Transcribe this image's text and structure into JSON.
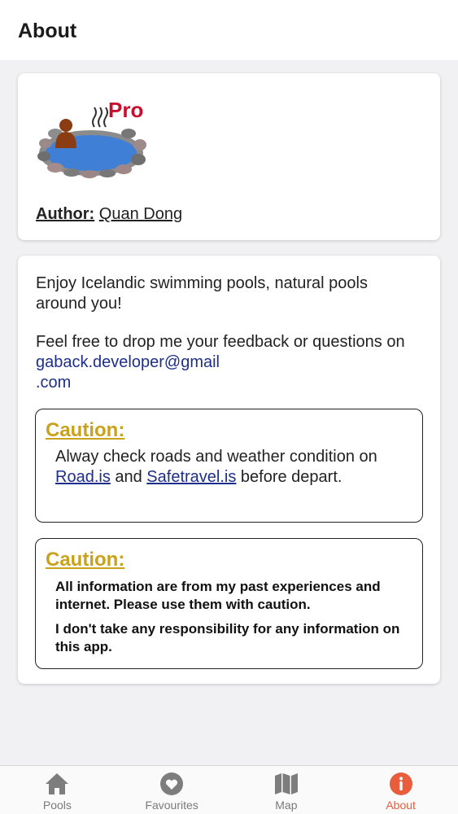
{
  "header": {
    "title": "About"
  },
  "author_card": {
    "logo_text": "Pro",
    "author_label": "Author:",
    "author_name": "Quan Dong"
  },
  "info_card": {
    "intro": "Enjoy Icelandic swimming pools, natural pools around you!",
    "feedback_prefix": "Feel free to drop me your feedback or questions on ",
    "feedback_email_1": "gaback.developer@gmail",
    "feedback_email_2": ".com",
    "caution1": {
      "title": "Caution:",
      "text_1": "Alway check roads and weather condition on ",
      "link_road": "Road.is",
      "text_and": " and ",
      "link_safe": "Safetravel.is",
      "text_2": " before depart."
    },
    "caution2": {
      "title": "Caution:",
      "line_1": "All information are from my past experiences and internet. Please use them with caution.",
      "line_2": "I don't take any responsibility for any information on this app."
    }
  },
  "tabs": [
    {
      "label": "Pools",
      "icon": "home-icon"
    },
    {
      "label": "Favourites",
      "icon": "heart-icon"
    },
    {
      "label": "Map",
      "icon": "map-icon"
    },
    {
      "label": "About",
      "icon": "info-icon",
      "active": true
    }
  ],
  "colors": {
    "accent": "#e85d3c",
    "caution": "#c9a21d",
    "link": "#1e2f8a"
  }
}
